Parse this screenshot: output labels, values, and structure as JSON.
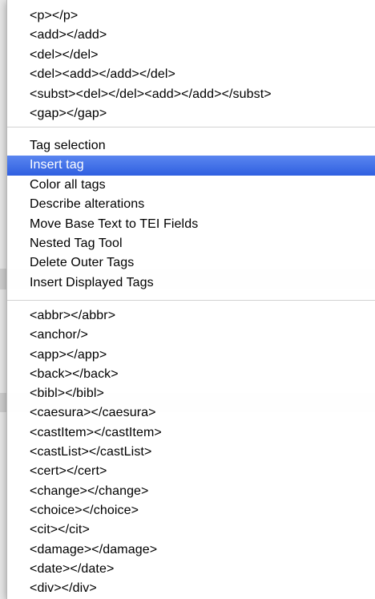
{
  "menu": {
    "tag_group_top": [
      "<p></p>",
      "<add></add>",
      "<del></del>",
      "<del><add></add></del>",
      "<subst><del></del><add></add></subst>",
      "<gap></gap>"
    ],
    "actions": [
      "Tag selection",
      "Insert tag",
      "Color all tags",
      "Describe alterations",
      "Move Base Text to TEI Fields",
      "Nested Tag Tool",
      "Delete Outer Tags",
      "Insert Displayed Tags"
    ],
    "selected_action": "Insert tag",
    "tag_list": [
      "<abbr></abbr>",
      "<anchor/>",
      "<app></app>",
      "<back></back>",
      "<bibl></bibl>",
      "<caesura></caesura>",
      "<castItem></castItem>",
      "<castList></castList>",
      "<cert></cert>",
      "<change></change>",
      "<choice></choice>",
      "<cit></cit>",
      "<damage></damage>",
      "<date></date>",
      "<div></div>"
    ]
  },
  "colors": {
    "highlight": "#3d6ee6",
    "menu_bg": "#ffffff"
  }
}
